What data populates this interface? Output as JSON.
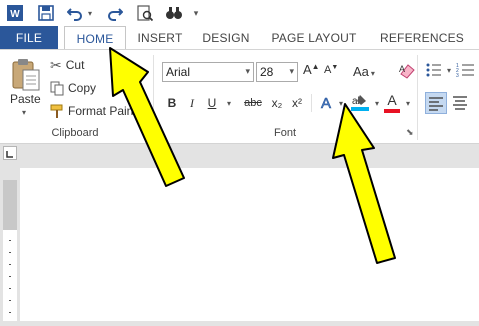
{
  "quick_access": {
    "icons": [
      "word-logo-icon",
      "save-icon",
      "undo-icon",
      "redo-icon",
      "print-preview-icon",
      "find-icon",
      "customize-icon"
    ],
    "logo_letter": "W"
  },
  "tabs": [
    {
      "label": "FILE"
    },
    {
      "label": "HOME"
    },
    {
      "label": "INSERT"
    },
    {
      "label": "DESIGN"
    },
    {
      "label": "PAGE LAYOUT"
    },
    {
      "label": "REFERENCES"
    }
  ],
  "clipboard": {
    "paste_label": "Paste",
    "cut_label": "Cut",
    "copy_label": "Copy",
    "format_painter_label": "Format Pain",
    "group_label": "Clipboard"
  },
  "font": {
    "font_name": "Arial",
    "font_size": "28",
    "grow_label": "A",
    "shrink_label": "A",
    "change_case_label": "Aa",
    "bold_label": "B",
    "italic_label": "I",
    "underline_label": "U",
    "strikethrough_label": "abc",
    "subscript_label": "x₂",
    "superscript_label": "x²",
    "text_effects_label": "A",
    "font_color_label": "A",
    "group_label": "Font"
  },
  "colors": {
    "accent": "#2b579a",
    "highlight": "#00b0f0",
    "font_color": "#e81123",
    "arrow_fill": "#ffff00",
    "arrow_stroke": "#000000"
  }
}
